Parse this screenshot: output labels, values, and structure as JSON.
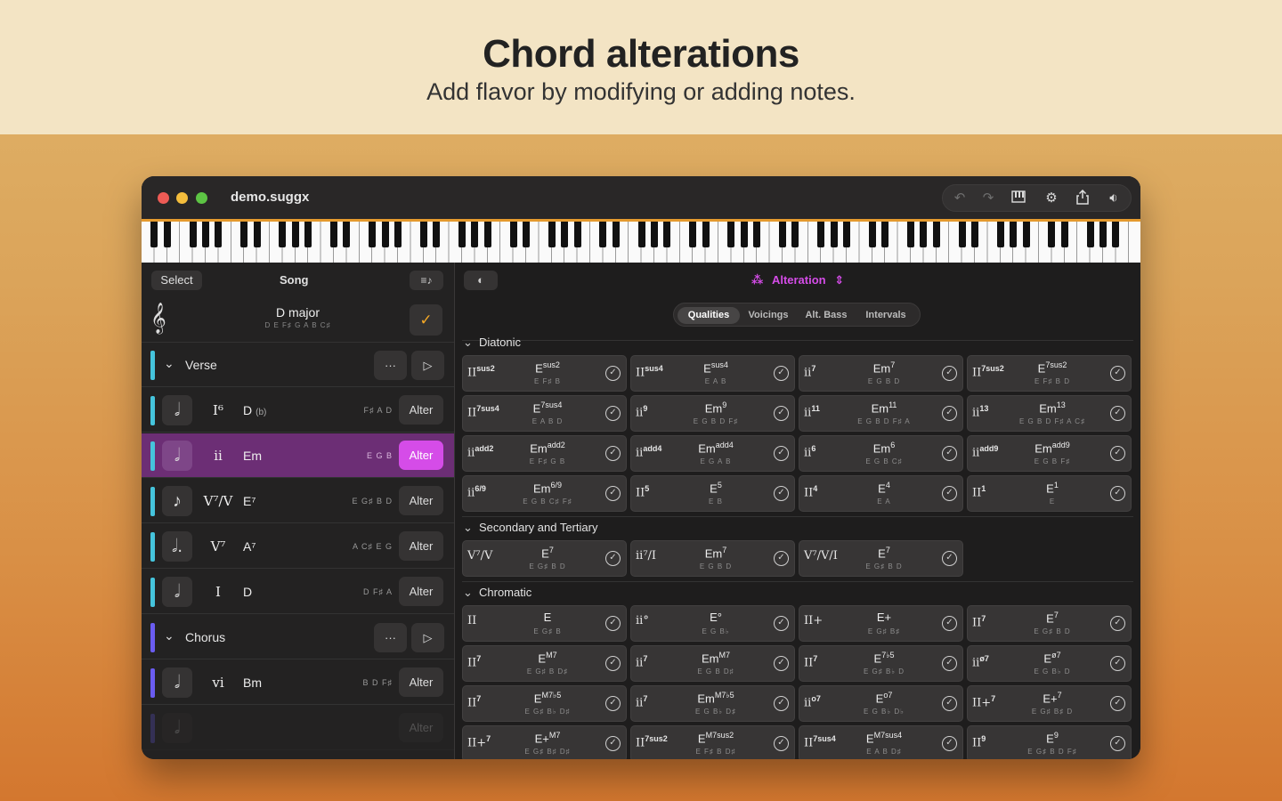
{
  "hero": {
    "title": "Chord alterations",
    "subtitle": "Add flavor by modifying or adding notes."
  },
  "window": {
    "filename": "demo.suggx",
    "toolbar_icons": [
      "undo-icon",
      "redo-icon",
      "piano-settings-icon",
      "gear-icon",
      "share-icon",
      "speaker-icon"
    ]
  },
  "left": {
    "select_label": "Select",
    "song_label": "Song",
    "key": {
      "name": "D major",
      "notes": "D E F♯ G A B C♯"
    },
    "sections": [
      {
        "name": "Verse",
        "color": "#45c4dc"
      },
      {
        "name": "Chorus",
        "color": "#6a5cf0"
      }
    ],
    "rows": [
      {
        "roman": "I⁶",
        "name": "D",
        "suffix": "(b)",
        "notes": "F♯ A D",
        "alter": "Alter",
        "glyph": "𝅗𝅥"
      },
      {
        "roman": "ii",
        "name": "Em",
        "suffix": "",
        "notes": "E G B",
        "alter": "Alter",
        "glyph": "𝅗𝅥"
      },
      {
        "roman": "V⁷/V",
        "name": "E⁷",
        "suffix": "",
        "notes": "E G♯ B D",
        "alter": "Alter",
        "glyph": "♪"
      },
      {
        "roman": "V⁷",
        "name": "A⁷",
        "suffix": "",
        "notes": "A C♯ E G",
        "alter": "Alter",
        "glyph": "𝅗𝅥."
      },
      {
        "roman": "I",
        "name": "D",
        "suffix": "",
        "notes": "D F♯ A",
        "alter": "Alter",
        "glyph": "𝅗𝅥"
      },
      {
        "roman": "vi",
        "name": "Bm",
        "suffix": "",
        "notes": "B D F♯",
        "alter": "Alter",
        "glyph": "𝅗𝅥"
      }
    ],
    "ghost_alter": "Alter"
  },
  "right": {
    "mode_label": "Alteration",
    "tabs": [
      "Qualities",
      "Voicings",
      "Alt. Bass",
      "Intervals"
    ],
    "groups": {
      "diatonic": "Diatonic",
      "secondary": "Secondary and Tertiary",
      "chromatic": "Chromatic"
    },
    "diatonic": [
      {
        "roman": "II",
        "rsup": "sus2",
        "name": "E",
        "nsup": "sus2",
        "notes": "E F♯ B"
      },
      {
        "roman": "II",
        "rsup": "sus4",
        "name": "E",
        "nsup": "sus4",
        "notes": "E A B"
      },
      {
        "roman": "ii",
        "rsup": "7",
        "name": "Em",
        "nsup": "7",
        "notes": "E G B D"
      },
      {
        "roman": "II",
        "rsup": "7sus2",
        "name": "E",
        "nsup": "7sus2",
        "notes": "E F♯ B D"
      },
      {
        "roman": "II",
        "rsup": "7sus4",
        "name": "E",
        "nsup": "7sus4",
        "notes": "E A B D"
      },
      {
        "roman": "ii",
        "rsup": "9",
        "name": "Em",
        "nsup": "9",
        "notes": "E G B D F♯"
      },
      {
        "roman": "ii",
        "rsup": "11",
        "name": "Em",
        "nsup": "11",
        "notes": "E G B D F♯ A"
      },
      {
        "roman": "ii",
        "rsup": "13",
        "name": "Em",
        "nsup": "13",
        "notes": "E G B D F♯ A C♯"
      },
      {
        "roman": "ii",
        "rsup": "add2",
        "name": "Em",
        "nsup": "add2",
        "notes": "E F♯ G B"
      },
      {
        "roman": "ii",
        "rsup": "add4",
        "name": "Em",
        "nsup": "add4",
        "notes": "E G A B"
      },
      {
        "roman": "ii",
        "rsup": "6",
        "name": "Em",
        "nsup": "6",
        "notes": "E G B C♯"
      },
      {
        "roman": "ii",
        "rsup": "add9",
        "name": "Em",
        "nsup": "add9",
        "notes": "E G B F♯"
      },
      {
        "roman": "ii",
        "rsup": "6/9",
        "name": "Em",
        "nsup": "6/9",
        "notes": "E G B C♯ F♯"
      },
      {
        "roman": "II",
        "rsup": "5",
        "name": "E",
        "nsup": "5",
        "notes": "E B"
      },
      {
        "roman": "II",
        "rsup": "4",
        "name": "E",
        "nsup": "4",
        "notes": "E A"
      },
      {
        "roman": "II",
        "rsup": "1",
        "name": "E",
        "nsup": "1",
        "notes": "E"
      }
    ],
    "secondary": [
      {
        "roman": "V⁷/V",
        "rsup": "",
        "name": "E",
        "nsup": "7",
        "notes": "E G♯ B D"
      },
      {
        "roman": "ii⁷/I",
        "rsup": "",
        "name": "Em",
        "nsup": "7",
        "notes": "E G B D"
      },
      {
        "roman": "V⁷/V/I",
        "rsup": "",
        "name": "E",
        "nsup": "7",
        "notes": "E G♯ B D"
      }
    ],
    "chromatic": [
      {
        "roman": "II",
        "rsup": "",
        "name": "E",
        "nsup": "",
        "notes": "E G♯ B"
      },
      {
        "roman": "ii°",
        "rsup": "",
        "name": "E°",
        "nsup": "",
        "notes": "E G B♭"
      },
      {
        "roman": "II+",
        "rsup": "",
        "name": "E+",
        "nsup": "",
        "notes": "E G♯ B♯"
      },
      {
        "roman": "II",
        "rsup": "7",
        "name": "E",
        "nsup": "7",
        "notes": "E G♯ B D"
      },
      {
        "roman": "II",
        "rsup": "7",
        "name": "E",
        "nsup": "M7",
        "notes": "E G♯ B D♯"
      },
      {
        "roman": "ii",
        "rsup": "7",
        "name": "Em",
        "nsup": "M7",
        "notes": "E G B D♯"
      },
      {
        "roman": "II",
        "rsup": "7",
        "name": "E",
        "nsup": "7♭5",
        "notes": "E G♯ B♭ D"
      },
      {
        "roman": "ii",
        "rsup": "ø7",
        "name": "E",
        "nsup": "ø7",
        "notes": "E G B♭ D"
      },
      {
        "roman": "II",
        "rsup": "7",
        "name": "E",
        "nsup": "M7♭5",
        "notes": "E G♯ B♭ D♯"
      },
      {
        "roman": "ii",
        "rsup": "7",
        "name": "Em",
        "nsup": "M7♭5",
        "notes": "E G B♭ D♯"
      },
      {
        "roman": "ii",
        "rsup": "o7",
        "name": "E",
        "nsup": "o7",
        "notes": "E G B♭ D♭"
      },
      {
        "roman": "II+",
        "rsup": "7",
        "name": "E+",
        "nsup": "7",
        "notes": "E G♯ B♯ D"
      },
      {
        "roman": "II+",
        "rsup": "7",
        "name": "E+",
        "nsup": "M7",
        "notes": "E G♯ B♯ D♯"
      },
      {
        "roman": "II",
        "rsup": "7sus2",
        "name": "E",
        "nsup": "M7sus2",
        "notes": "E F♯ B D♯"
      },
      {
        "roman": "II",
        "rsup": "7sus4",
        "name": "E",
        "nsup": "M7sus4",
        "notes": "E A B D♯"
      },
      {
        "roman": "II",
        "rsup": "9",
        "name": "E",
        "nsup": "9",
        "notes": "E G♯ B D F♯"
      }
    ],
    "colors": {
      "accent": "#d54ce8",
      "highlight_red": "#d94b4b"
    }
  }
}
